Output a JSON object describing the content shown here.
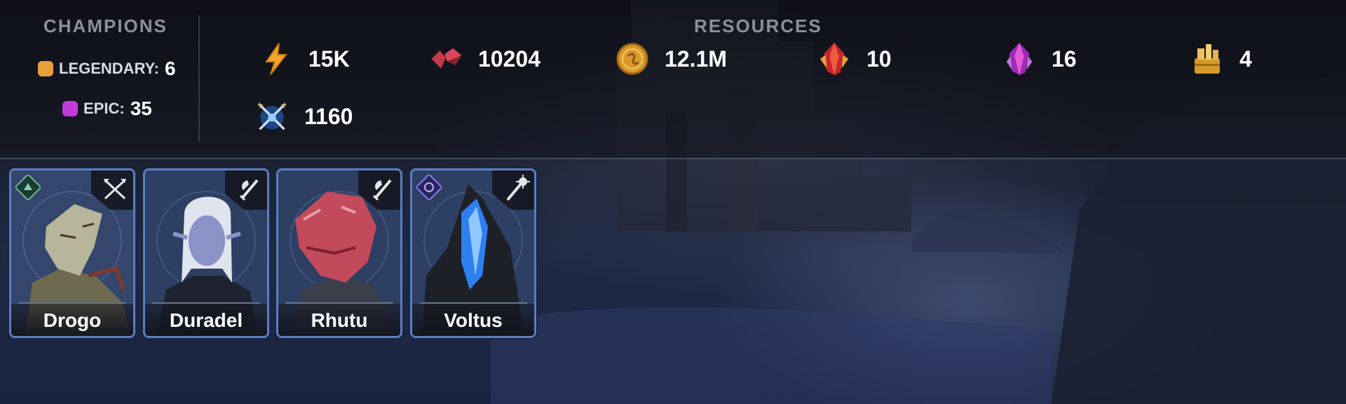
{
  "champions": {
    "title": "CHAMPIONS",
    "rarities": [
      {
        "label": "LEGENDARY:",
        "count": "6",
        "color": "#e8a13a"
      },
      {
        "label": "EPIC:",
        "count": "35",
        "color": "#c43ad9"
      }
    ]
  },
  "resources": {
    "title": "RESOURCES",
    "items": [
      {
        "icon": "energy-bolt-icon",
        "value": "15K"
      },
      {
        "icon": "ruby-gems-icon",
        "value": "10204"
      },
      {
        "icon": "silver-coin-icon",
        "value": "12.1M"
      },
      {
        "icon": "sacred-shard-icon",
        "value": "10"
      },
      {
        "icon": "void-shard-icon",
        "value": "16"
      },
      {
        "icon": "gold-chest-icon",
        "value": "4"
      },
      {
        "icon": "arena-tokens-icon",
        "value": "1160"
      }
    ]
  },
  "cards": [
    {
      "name": "Drogo",
      "affinity": "force-affinity-icon",
      "role": "crossbow-icon"
    },
    {
      "name": "Duradel",
      "affinity": "none",
      "role": "sword-axe-icon"
    },
    {
      "name": "Rhutu",
      "affinity": "none",
      "role": "sword-axe-icon"
    },
    {
      "name": "Voltus",
      "affinity": "magic-affinity-icon",
      "role": "staff-icon"
    }
  ]
}
